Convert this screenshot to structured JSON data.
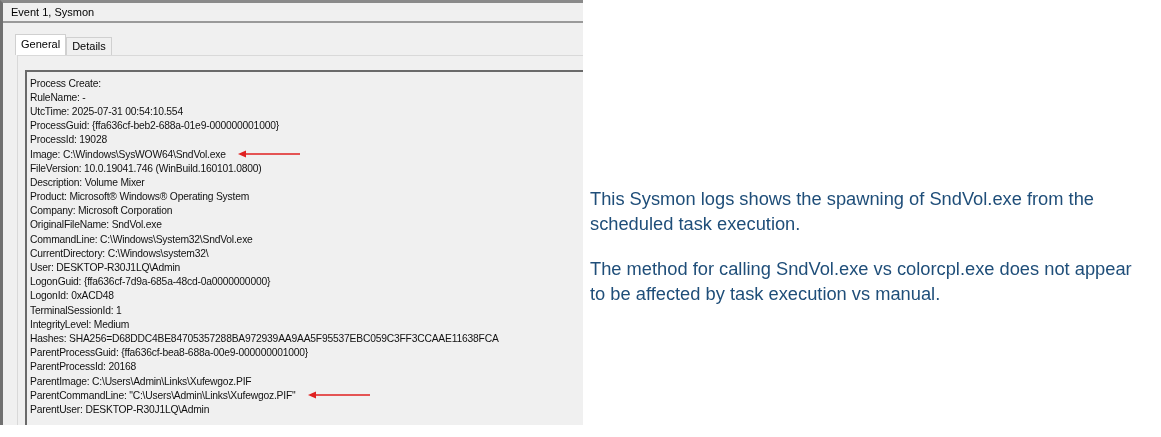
{
  "window": {
    "title": "Event 1, Sysmon"
  },
  "tabs": [
    {
      "label": "General",
      "selected": true
    },
    {
      "label": "Details",
      "selected": false
    }
  ],
  "event_lines": [
    {
      "text": "Process Create:",
      "arrow": false
    },
    {
      "text": "RuleName: -",
      "arrow": false
    },
    {
      "text": "UtcTime: 2025-07-31 00:54:10.554",
      "arrow": false
    },
    {
      "text": "ProcessGuid: {ffa636cf-beb2-688a-01e9-000000001000}",
      "arrow": false
    },
    {
      "text": "ProcessId: 19028",
      "arrow": false
    },
    {
      "text": "Image: C:\\Windows\\SysWOW64\\SndVol.exe",
      "arrow": true
    },
    {
      "text": "FileVersion: 10.0.19041.746 (WinBuild.160101.0800)",
      "arrow": false
    },
    {
      "text": "Description: Volume Mixer",
      "arrow": false
    },
    {
      "text": "Product: Microsoft® Windows® Operating System",
      "arrow": false
    },
    {
      "text": "Company: Microsoft Corporation",
      "arrow": false
    },
    {
      "text": "OriginalFileName: SndVol.exe",
      "arrow": false
    },
    {
      "text": "CommandLine: C:\\Windows\\System32\\SndVol.exe",
      "arrow": false
    },
    {
      "text": "CurrentDirectory: C:\\Windows\\system32\\",
      "arrow": false
    },
    {
      "text": "User: DESKTOP-R30J1LQ\\Admin",
      "arrow": false
    },
    {
      "text": "LogonGuid: {ffa636cf-7d9a-685a-48cd-0a0000000000}",
      "arrow": false
    },
    {
      "text": "LogonId: 0xACD48",
      "arrow": false
    },
    {
      "text": "TerminalSessionId: 1",
      "arrow": false
    },
    {
      "text": "IntegrityLevel: Medium",
      "arrow": false
    },
    {
      "text": "Hashes: SHA256=D68DDC4BE84705357288BA972939AA9AA5F95537EBC059C3FF3CCAAE11638FCA",
      "arrow": false
    },
    {
      "text": "ParentProcessGuid: {ffa636cf-bea8-688a-00e9-000000001000}",
      "arrow": false
    },
    {
      "text": "ParentProcessId: 20168",
      "arrow": false
    },
    {
      "text": "ParentImage: C:\\Users\\Admin\\Links\\Xufewgoz.PIF",
      "arrow": false
    },
    {
      "text": "ParentCommandLine: \"C:\\Users\\Admin\\Links\\Xufewgoz.PIF\"",
      "arrow": true
    },
    {
      "text": "ParentUser: DESKTOP-R30J1LQ\\Admin",
      "arrow": false
    }
  ],
  "notes": [
    "This Sysmon logs shows the spawning of SndVol.exe from the scheduled task execution.",
    "The method for calling SndVol.exe vs colorcpl.exe does not appear to be affected by task execution vs manual."
  ]
}
